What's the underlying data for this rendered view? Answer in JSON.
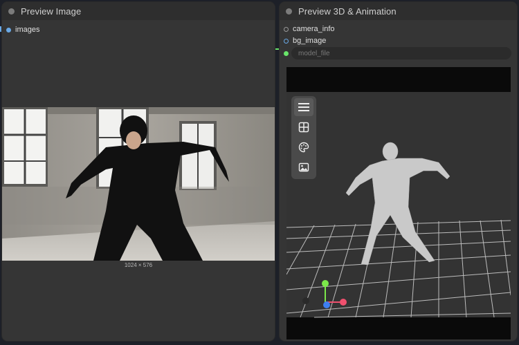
{
  "left_node": {
    "title": "Preview Image",
    "slot_label": "images",
    "image_dimensions": "1024 × 576"
  },
  "right_node": {
    "title": "Preview 3D & Animation",
    "slots": [
      {
        "label": "camera_info"
      },
      {
        "label": "bg_image"
      }
    ],
    "model_file_placeholder": "model_file"
  },
  "toolbar": {
    "icons": [
      "menu-icon",
      "grid-layout-icon",
      "palette-icon",
      "image-icon"
    ]
  },
  "colors": {
    "node_bg": "#353535",
    "header_bg": "#2e2e2e",
    "canvas_bg": "#1d2028",
    "slot_blue": "#6aa9e6",
    "slot_green": "#69e56a",
    "axis_x": "#f0506e",
    "axis_y": "#7ce84a",
    "axis_z": "#3d7ef0"
  }
}
